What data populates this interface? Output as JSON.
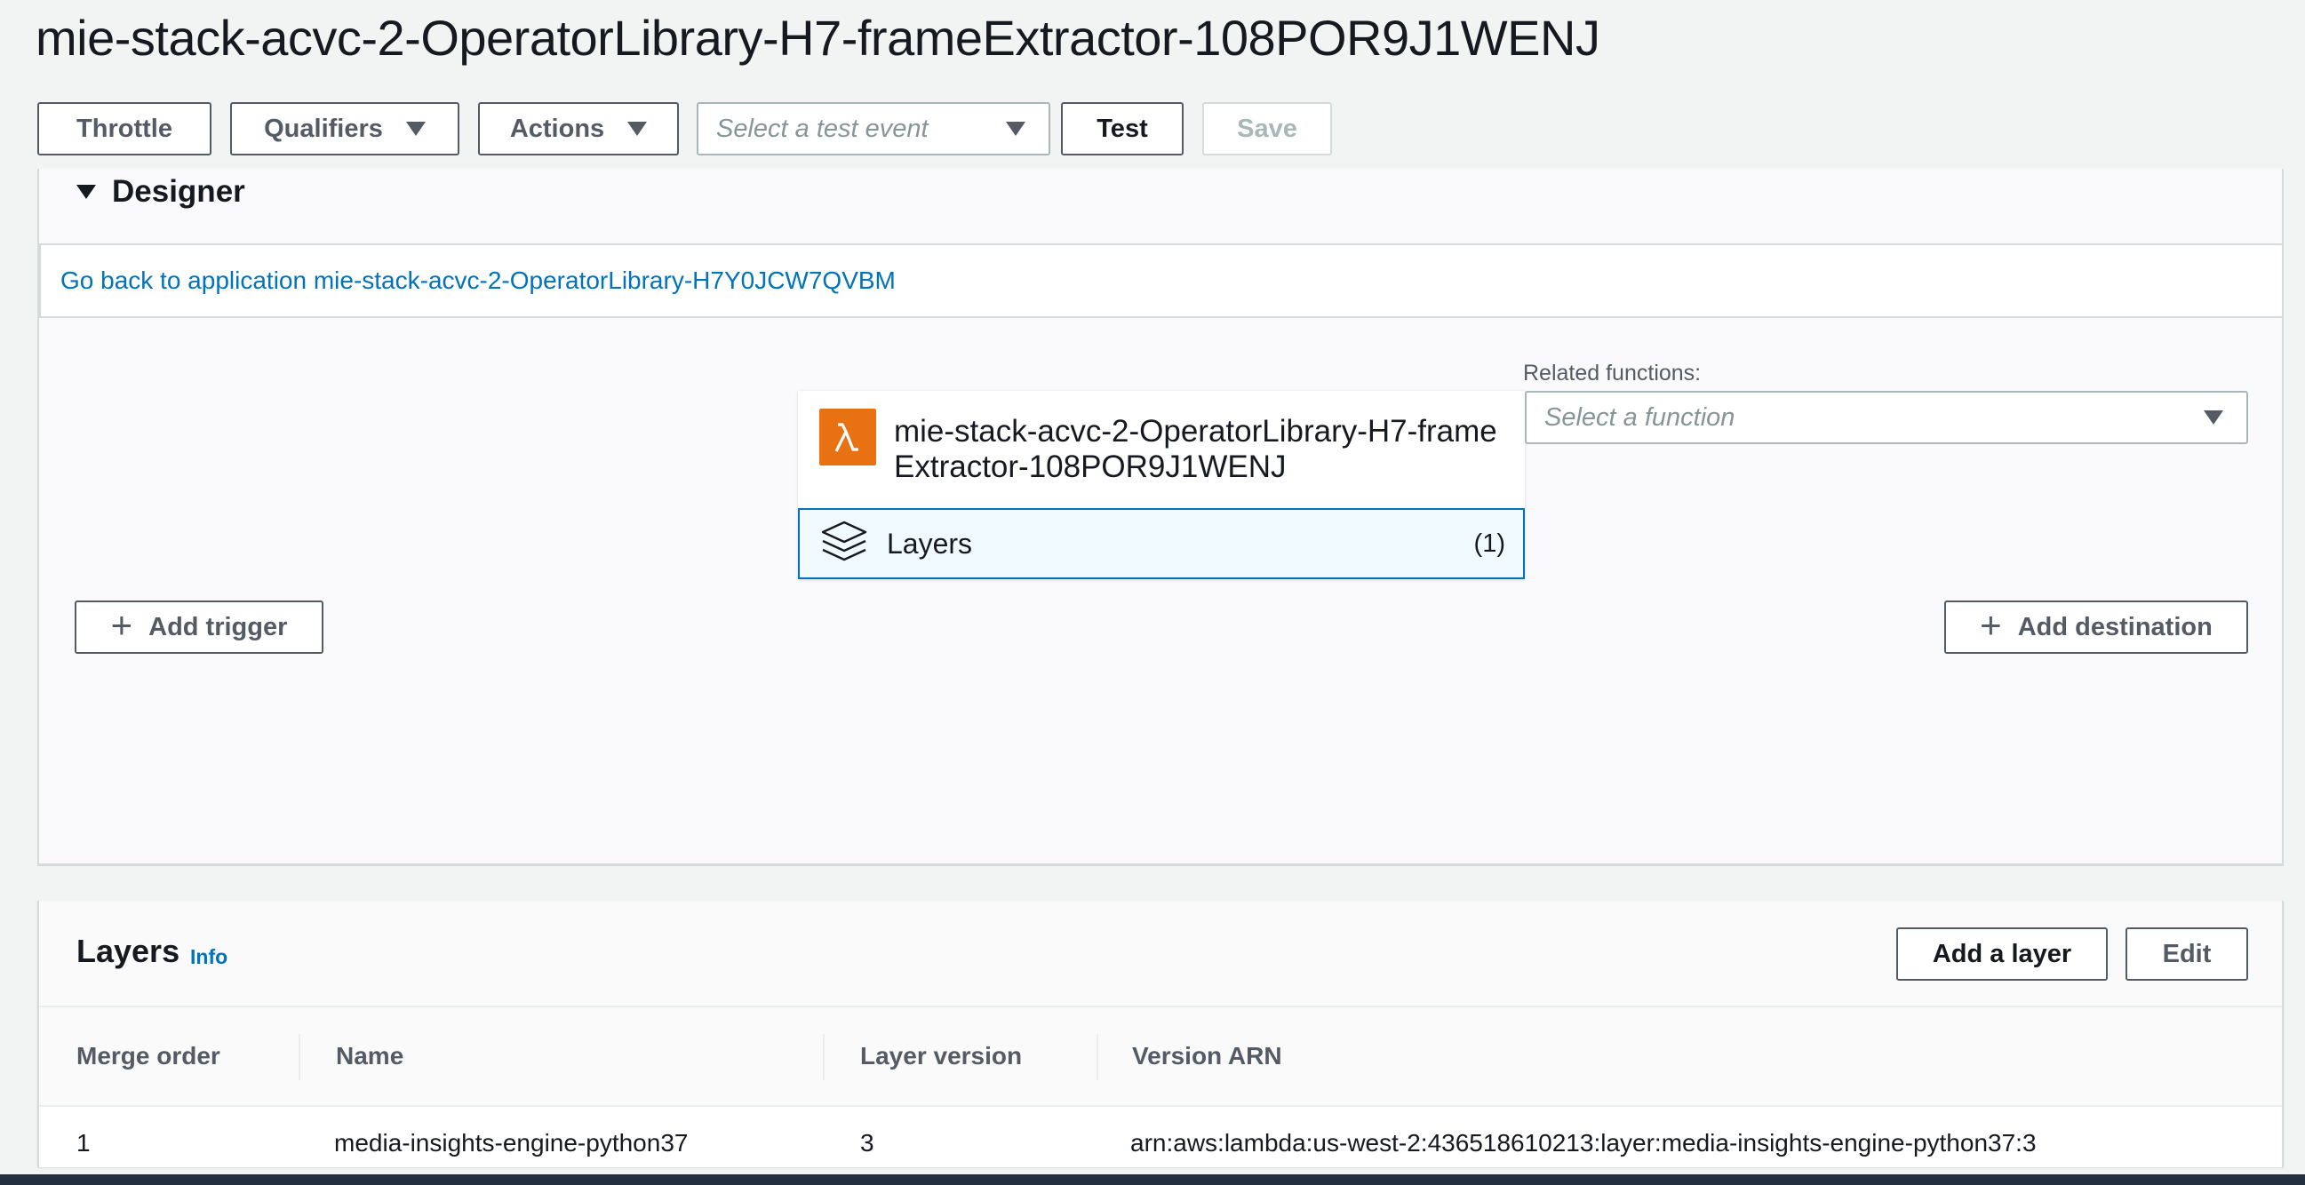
{
  "page": {
    "title": "mie-stack-acvc-2-OperatorLibrary-H7-frameExtractor-108POR9J1WENJ"
  },
  "toolbar": {
    "throttle_label": "Throttle",
    "qualifiers_label": "Qualifiers",
    "actions_label": "Actions",
    "test_event_placeholder": "Select a test event",
    "test_label": "Test",
    "save_label": "Save"
  },
  "designer": {
    "header": "Designer",
    "app_link": "Go back to application mie-stack-acvc-2-OperatorLibrary-H7Y0JCW7QVBM",
    "function_name": "mie-stack-acvc-2-OperatorLibrary-H7-frameExtractor-108POR9J1WENJ",
    "layers_label": "Layers",
    "layers_count": "(1)",
    "related_label": "Related functions:",
    "related_placeholder": "Select a function",
    "add_trigger_label": "Add trigger",
    "add_destination_label": "Add destination"
  },
  "layers": {
    "title": "Layers",
    "info_label": "Info",
    "add_layer_label": "Add a layer",
    "edit_label": "Edit",
    "columns": [
      "Merge order",
      "Name",
      "Layer version",
      "Version ARN"
    ],
    "rows": [
      {
        "merge_order": "1",
        "name": "media-insights-engine-python37",
        "version": "3",
        "arn": "arn:aws:lambda:us-west-2:436518610213:layer:media-insights-engine-python37:3"
      }
    ]
  },
  "colors": {
    "accent": "#0073bb",
    "lambda_orange": "#e87212",
    "nav_dark": "#232f3e"
  }
}
